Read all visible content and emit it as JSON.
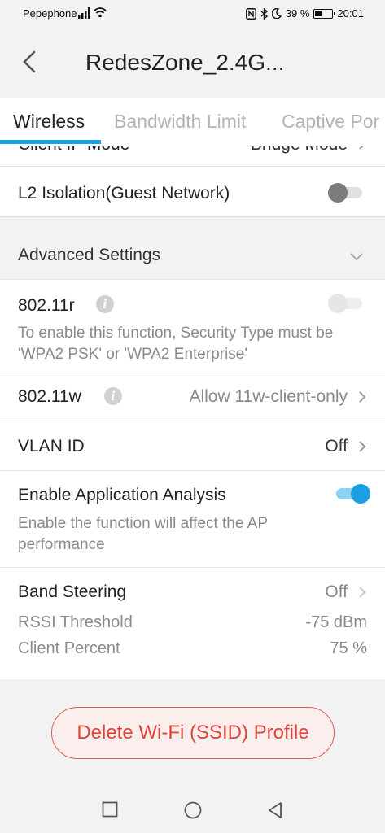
{
  "status_bar": {
    "carrier": "Pepephone",
    "battery": "39 %",
    "time": "20:01",
    "icons": [
      "signal-icon",
      "wifi-icon",
      "nfc-icon",
      "bluetooth-icon",
      "moon-icon",
      "battery-icon"
    ]
  },
  "app_bar": {
    "title": "RedesZone_2.4G..."
  },
  "tabs": [
    {
      "label": "Wireless",
      "active": true
    },
    {
      "label": "Bandwidth Limit",
      "active": false
    },
    {
      "label": "Captive Por",
      "active": false
    }
  ],
  "settings": {
    "client_ip_mode": {
      "label": "Client IP Mode",
      "value": "Bridge Mode"
    },
    "l2_isolation": {
      "label": "L2 Isolation(Guest Network)",
      "enabled": false
    },
    "advanced_header": "Advanced Settings",
    "r80211": {
      "label": "802.11r",
      "enabled": false,
      "description": "To enable this function, Security Type must be 'WPA2 PSK' or 'WPA2 Enterprise'"
    },
    "w80211": {
      "label": "802.11w",
      "value": "Allow 11w-client-only"
    },
    "vlan_id": {
      "label": "VLAN ID",
      "value": "Off"
    },
    "app_analysis": {
      "label": "Enable Application Analysis",
      "enabled": true,
      "description": "Enable the function will affect the AP performance"
    },
    "band_steering": {
      "label": "Band Steering",
      "value": "Off",
      "rssi_label": "RSSI Threshold",
      "rssi_value": "-75 dBm",
      "client_percent_label": "Client Percent",
      "client_percent_value": "75 %"
    }
  },
  "delete_button": "Delete Wi-Fi (SSID) Profile",
  "nav_bar": [
    "recents-square-icon",
    "home-circle-icon",
    "back-triangle-icon"
  ],
  "colors": {
    "accent": "#1a9fe4",
    "danger": "#e0453b",
    "background": "#f2f2f2"
  }
}
